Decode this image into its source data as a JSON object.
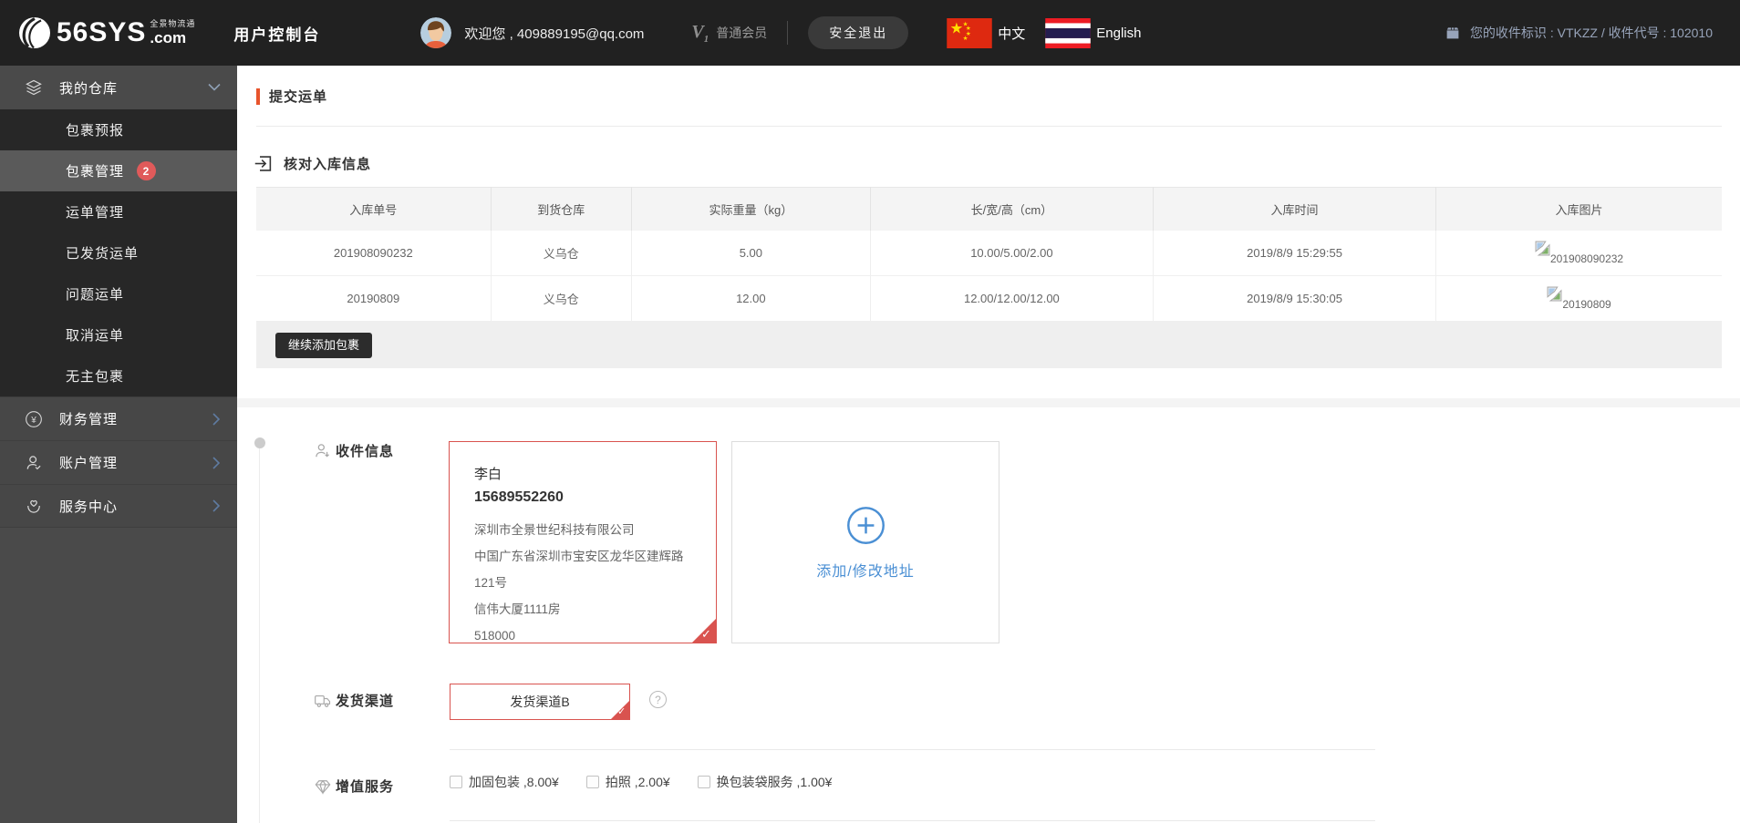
{
  "colors": {
    "header_bg": "#212121",
    "sidebar_bg": "#4a4a4a",
    "submenu_bg": "#272727",
    "active_item_bg": "#5a5a5a",
    "accent_orange": "#e8542c",
    "badge_red": "#e05a5a",
    "selected_border_red": "#d9534f",
    "link_blue": "#4a8fd4",
    "receiver_text": "#98a4ba"
  },
  "header": {
    "brand": "56SYS",
    "brand_tld": ".com",
    "brand_slogan": "全景物流通",
    "console_title": "用户控制台",
    "welcome": "欢迎您 , 409889195@qq.com",
    "member_level": "普通会员",
    "logout_label": "安全退出",
    "lang_chinese": "中文",
    "lang_english": "English",
    "receiver_id_text": "您的收件标识 : VTKZZ / 收件代号 : 102010"
  },
  "sidebar": {
    "warehouse_label": "我的仓库",
    "items": [
      {
        "label": "包裹预报",
        "badge": ""
      },
      {
        "label": "包裹管理",
        "badge": "2"
      },
      {
        "label": "运单管理",
        "badge": ""
      },
      {
        "label": "已发货运单",
        "badge": ""
      },
      {
        "label": "问题运单",
        "badge": ""
      },
      {
        "label": "取消运单",
        "badge": ""
      },
      {
        "label": "无主包裹",
        "badge": ""
      }
    ],
    "bottom_items": [
      {
        "label": "财务管理"
      },
      {
        "label": "账户管理"
      },
      {
        "label": "服务中心"
      }
    ]
  },
  "main": {
    "page_title": "提交运单",
    "checkin_section_title": "核对入库信息",
    "table": {
      "headers": [
        "入库单号",
        "到货仓库",
        "实际重量（kg）",
        "长/宽/高（cm）",
        "入库时间",
        "入库图片"
      ],
      "rows": [
        {
          "order_no": "201908090232",
          "warehouse": "义乌仓",
          "weight": "5.00",
          "dims": "10.00/5.00/2.00",
          "time": "2019/8/9 15:29:55",
          "image_alt": "201908090232"
        },
        {
          "order_no": "20190809",
          "warehouse": "义乌仓",
          "weight": "12.00",
          "dims": "12.00/12.00/12.00",
          "time": "2019/8/9 15:30:05",
          "image_alt": "20190809"
        }
      ]
    },
    "continue_add_button": "继续添加包裹",
    "recipient": {
      "label": "收件信息",
      "card": {
        "name": "李白",
        "phone": "15689552260",
        "company": "深圳市全景世纪科技有限公司",
        "address1": "中国广东省深圳市宝安区龙华区建辉路",
        "address2": "121号",
        "address3": "信伟大厦1111房",
        "zip": "518000"
      },
      "add_card_label": "添加/修改地址"
    },
    "channel": {
      "label": "发货渠道",
      "selected": "发货渠道B",
      "help_glyph": "?"
    },
    "services": {
      "label": "增值服务",
      "options": [
        {
          "label": "加固包装 ,8.00¥",
          "checked": false
        },
        {
          "label": "拍照 ,2.00¥",
          "checked": false
        },
        {
          "label": "换包装袋服务 ,1.00¥",
          "checked": false
        }
      ]
    }
  }
}
